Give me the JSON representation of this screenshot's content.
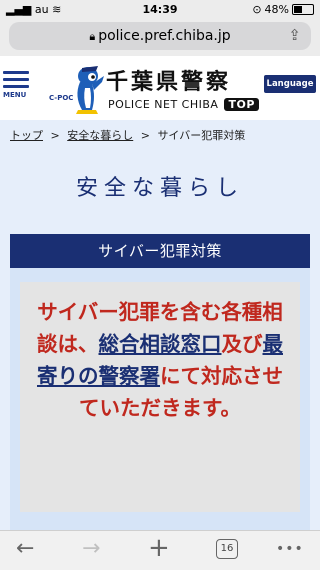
{
  "status_bar": {
    "carrier": "au",
    "time": "14:39",
    "battery": "48%",
    "battery_level": 0.48
  },
  "browser": {
    "url": "police.pref.chiba.jp",
    "tab_count": "16"
  },
  "site": {
    "menu_label": "MENU",
    "logo_tag": "C-POC",
    "title": "千葉県警察",
    "subtitle": "POLICE NET CHIBA",
    "top_badge": "TOP",
    "language_label": "Language",
    "brand_color": "#1a2f73"
  },
  "breadcrumb": [
    {
      "label": "トップ"
    },
    {
      "label": "安全な暮らし"
    },
    {
      "label": "サイバー犯罪対策"
    }
  ],
  "breadcrumb_separator": ">",
  "page_heading": "安全な暮らし",
  "panel": {
    "title": "サイバー犯罪対策",
    "notice": {
      "part1": "サイバー犯罪を含む各種相談は、",
      "link1": "総合相談窓口",
      "part2": "及び",
      "link2": "最寄りの警察署",
      "part3": "にて対応させていただきます。",
      "text_color": "#c0281e"
    }
  },
  "toolbar": {
    "back_icon": "←",
    "forward_icon": "→",
    "new_tab_icon": "+",
    "more_icon": "•••"
  }
}
